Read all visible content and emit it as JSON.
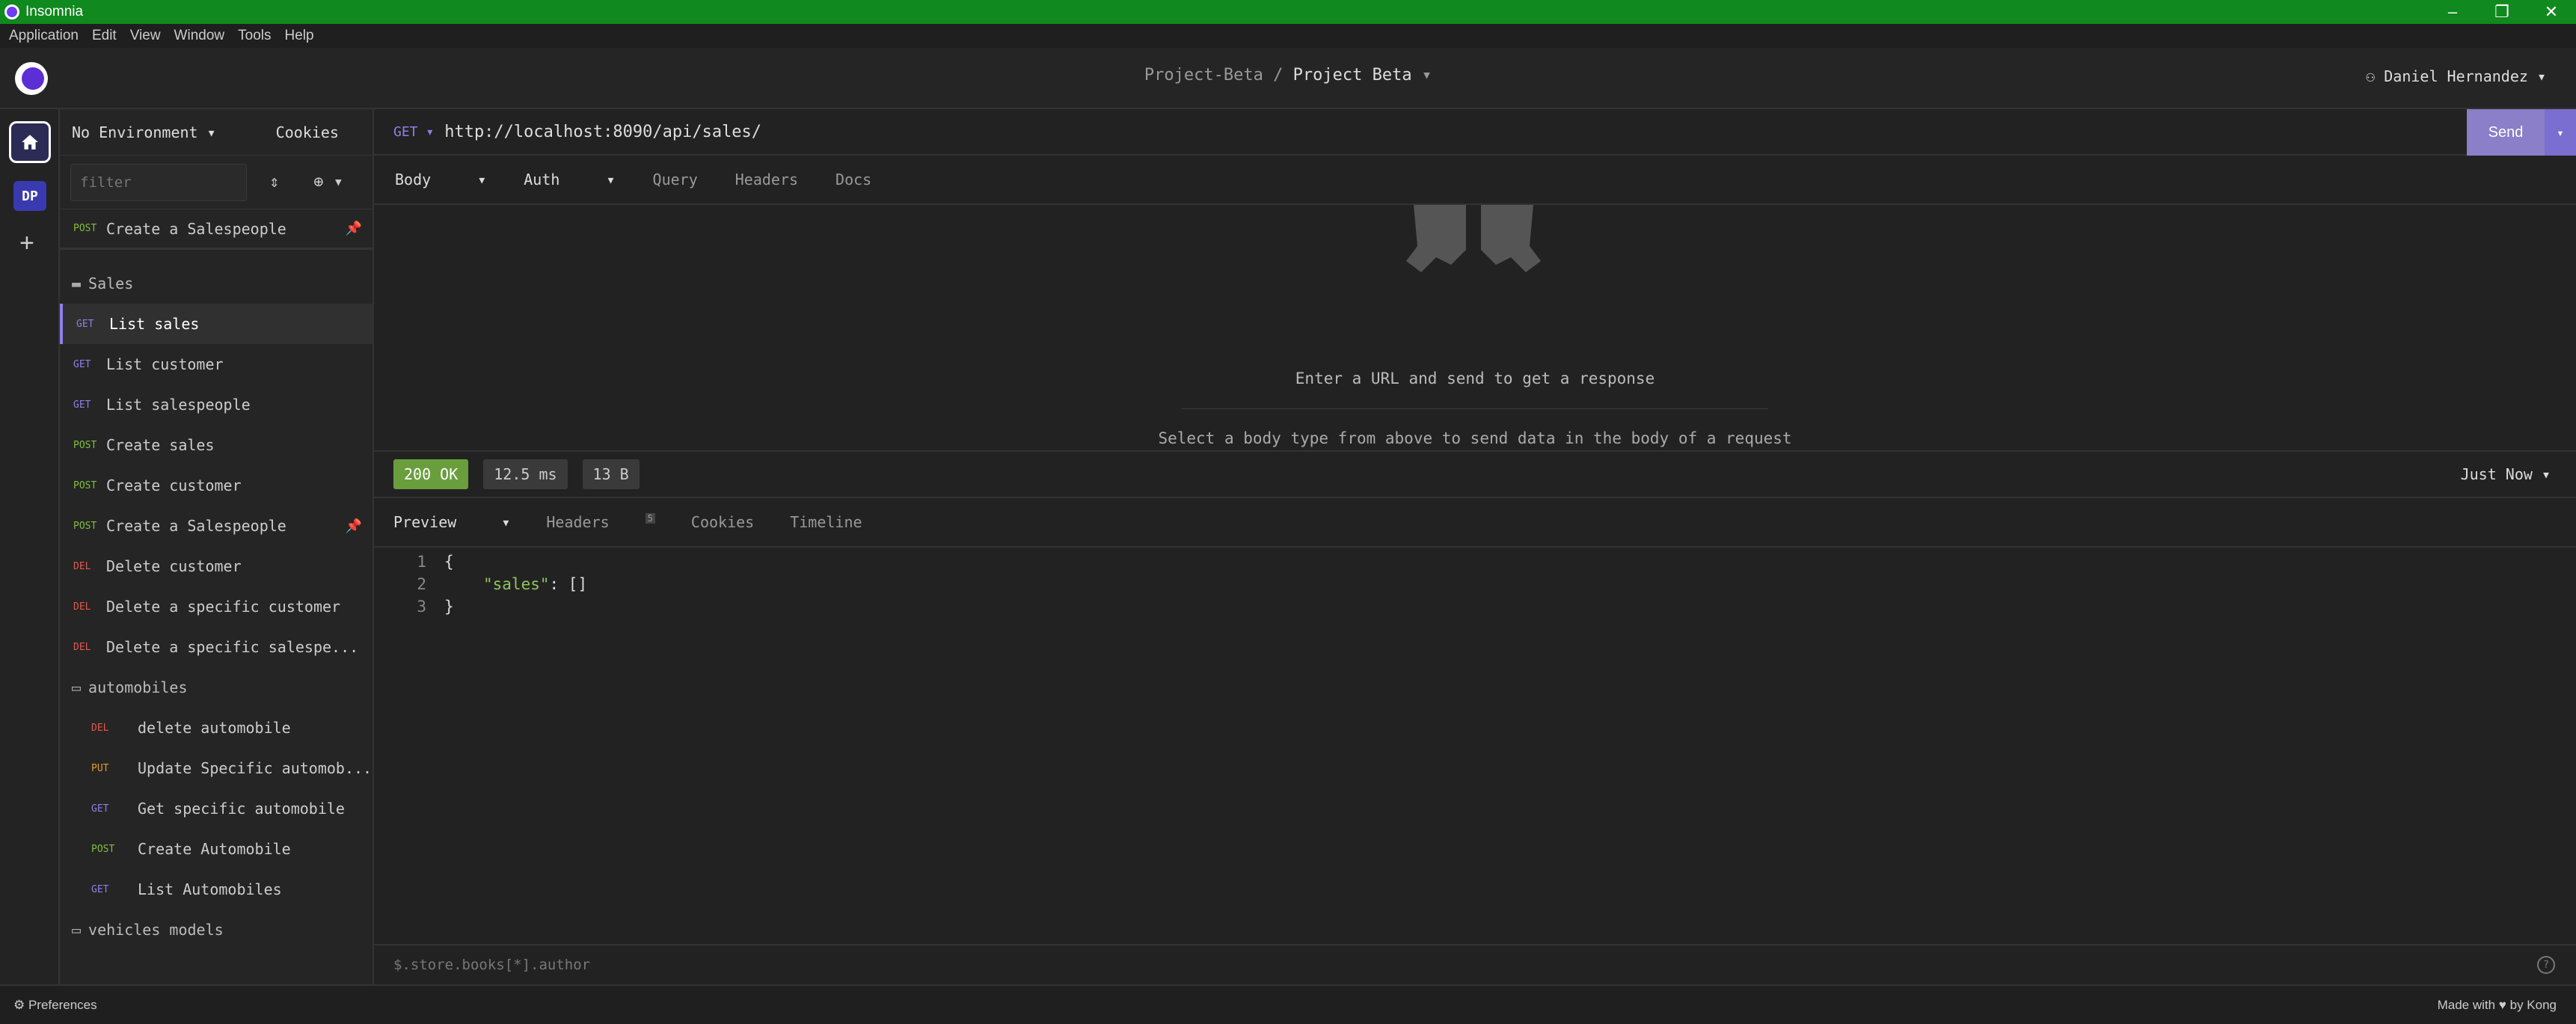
{
  "window": {
    "title": "Insomnia",
    "controls": [
      "–",
      "❐",
      "✕"
    ]
  },
  "menu": [
    "Application",
    "Edit",
    "View",
    "Window",
    "Tools",
    "Help"
  ],
  "header": {
    "project": "Project-Beta",
    "separator": "/",
    "workspace": "Project Beta",
    "user": "Daniel Hernandez"
  },
  "rail": {
    "workspace_badge": "DP"
  },
  "sidebar": {
    "environment": "No Environment",
    "cookies": "Cookies",
    "filter_placeholder": "filter",
    "pinned": {
      "method": "POST",
      "label": "Create a Salespeople"
    },
    "folders": [
      {
        "name": "Sales",
        "items": [
          {
            "method": "GET",
            "label": "List sales",
            "active": true
          },
          {
            "method": "GET",
            "label": "List customer"
          },
          {
            "method": "GET",
            "label": "List salespeople"
          },
          {
            "method": "POST",
            "label": "Create sales"
          },
          {
            "method": "POST",
            "label": "Create customer"
          },
          {
            "method": "POST",
            "label": "Create a Salespeople",
            "pinned": true
          },
          {
            "method": "DEL",
            "label": "Delete customer"
          },
          {
            "method": "DEL",
            "label": "Delete a specific customer"
          },
          {
            "method": "DEL",
            "label": "Delete a specific salespe..."
          }
        ]
      },
      {
        "name": "automobiles",
        "items": [
          {
            "method": "DEL",
            "label": "delete automobile"
          },
          {
            "method": "PUT",
            "label": "Update Specific automob..."
          },
          {
            "method": "GET",
            "label": "Get specific automobile"
          },
          {
            "method": "POST",
            "label": "Create Automobile"
          },
          {
            "method": "GET",
            "label": "List Automobiles"
          }
        ]
      },
      {
        "name": "vehicles models",
        "items": []
      }
    ]
  },
  "request": {
    "method": "GET",
    "url": "http://localhost:8090/api/sales/",
    "send": "Send",
    "tabs": [
      "Body",
      "Auth",
      "Query",
      "Headers",
      "Docs"
    ],
    "empty_hint_1": "Enter a URL and send to get a response",
    "empty_hint_2": "Select a body type from above to send data in the body of a request"
  },
  "response": {
    "status": "200 OK",
    "time": "12.5 ms",
    "size": "13 B",
    "when": "Just Now",
    "tabs": [
      "Preview",
      "Headers",
      "Cookies",
      "Timeline"
    ],
    "headers_count": "5",
    "code": [
      {
        "ln": "1",
        "text": "{"
      },
      {
        "ln": "2",
        "key": "\"sales\"",
        "rest": ": []"
      },
      {
        "ln": "3",
        "text": "}"
      }
    ],
    "filter_placeholder": "$.store.books[*].author"
  },
  "footer": {
    "preferences": "Preferences",
    "made_with": "Made with ♥ by Kong"
  },
  "colors": {
    "titlebar": "#10891e",
    "accent": "#8f7fe8",
    "send": "#8a7fc8",
    "ok": "#6a9e3d"
  }
}
